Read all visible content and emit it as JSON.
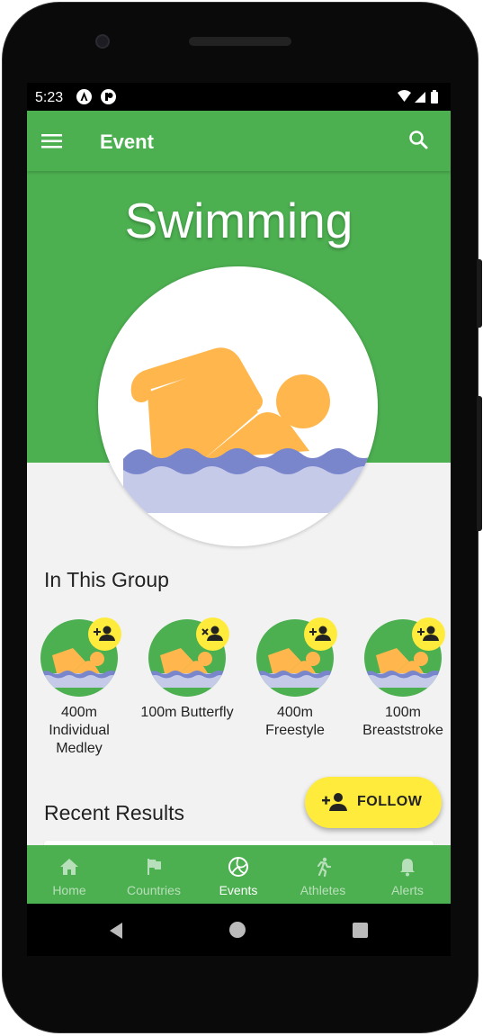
{
  "status": {
    "time": "5:23"
  },
  "appbar": {
    "title": "Event"
  },
  "hero": {
    "title": "Swimming"
  },
  "group": {
    "title": "In This Group",
    "items": [
      {
        "label": "400m Individual Medley",
        "follow_state": "follow"
      },
      {
        "label": "100m Butterfly",
        "follow_state": "unfollow"
      },
      {
        "label": "400m Freestyle",
        "follow_state": "follow"
      },
      {
        "label": "100m Breaststroke",
        "follow_state": "follow"
      }
    ]
  },
  "results": {
    "title": "Recent Results"
  },
  "fab": {
    "label": "FOLLOW"
  },
  "bottom_nav": {
    "items": [
      {
        "label": "Home",
        "icon": "home-icon"
      },
      {
        "label": "Countries",
        "icon": "flag-icon"
      },
      {
        "label": "Events",
        "icon": "volleyball-icon"
      },
      {
        "label": "Athletes",
        "icon": "run-icon"
      },
      {
        "label": "Alerts",
        "icon": "bell-icon"
      }
    ],
    "active": "Events"
  },
  "colors": {
    "primary": "#4caf50",
    "accent": "#ffeb3b",
    "swimmer": "#ffb74d",
    "water_dark": "#7986cb",
    "water_light": "#c5cae9"
  }
}
